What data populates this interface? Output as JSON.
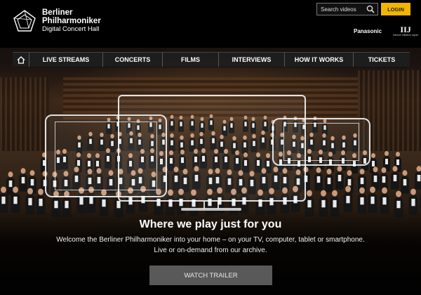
{
  "brand": {
    "line1": "Berliner",
    "line2": "Philharmoniker",
    "line3": "Digital Concert Hall"
  },
  "search": {
    "placeholder": "Search videos",
    "icon": "search-icon"
  },
  "login_label": "LOGIN",
  "sponsors": {
    "primary": "Panasonic",
    "secondary_mark": "IIJ",
    "secondary_sub": "Internet Initiative Japan"
  },
  "nav": {
    "home_icon": "home-icon",
    "items": [
      {
        "label": "LIVE STREAMS"
      },
      {
        "label": "CONCERTS"
      },
      {
        "label": "FILMS"
      },
      {
        "label": "INTERVIEWS"
      },
      {
        "label": "HOW IT WORKS"
      },
      {
        "label": "TICKETS"
      }
    ]
  },
  "hero": {
    "headline": "Where we play just for you",
    "description": "Welcome the Berliner Philharmoniker into your home – on your TV, computer, tablet or smartphone. Live or on-demand from our archive.",
    "cta_label": "WATCH TRAILER"
  },
  "colors": {
    "login_bg": "#f1b400",
    "nav_bg": "#1e1e1e",
    "cta_bg": "#595959"
  }
}
